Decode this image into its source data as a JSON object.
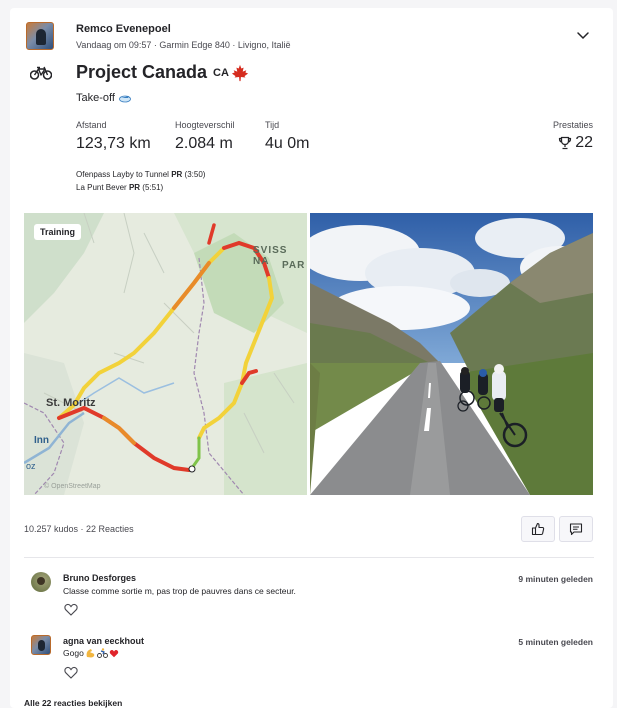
{
  "activity": {
    "athlete_name": "Remco Evenepoel",
    "meta": "Vandaag om 09:57 · Garmin Edge 840 · Livigno, Italië",
    "title": "Project Canada",
    "title_badge": "CA",
    "description": "Take-off",
    "stats": [
      {
        "label": "Afstand",
        "value": "123,73 km"
      },
      {
        "label": "Hoogteverschil",
        "value": "2.084 m"
      },
      {
        "label": "Tijd",
        "value": "4u 0m"
      }
    ],
    "achievements": {
      "label": "Prestaties",
      "value": "22"
    },
    "segments": [
      {
        "name": "Ofenpass Layby to Tunnel",
        "pr": "PR",
        "time": "(3:50)"
      },
      {
        "name": "La Punt Bever",
        "pr": "PR",
        "time": "(5:51)"
      }
    ]
  },
  "map": {
    "badge": "Training",
    "labels": {
      "park_line1": "SVISS NA",
      "park_line2": "PAR",
      "town": "St. Moritz",
      "river": "Inn",
      "extra": "oz",
      "attribution": "© OpenStreetMap"
    }
  },
  "social": {
    "summary": "10.257 kudos · 22 Reacties",
    "view_all": "Alle 22 reacties bekijken"
  },
  "comments": [
    {
      "name": "Bruno Desforges",
      "text": "Classe comme sortie m, pas trop de pauvres dans ce secteur.",
      "time": "9 minuten geleden"
    },
    {
      "name": "agna van eeckhout",
      "text": "Gogo",
      "time": "5 minuten geleden"
    }
  ],
  "colors": {
    "text": "#242428",
    "muted": "#494950",
    "route_red": "#e03a2a",
    "route_yellow": "#f2d23a",
    "accent_orange": "#fc5200"
  },
  "icons": {
    "bike": "bike-icon",
    "chevron": "chevron-down-icon",
    "trophy": "trophy-icon",
    "kudos": "thumbs-up-icon",
    "comment": "comment-icon",
    "like": "heart-outline-icon",
    "leaf": "maple-leaf-icon"
  }
}
